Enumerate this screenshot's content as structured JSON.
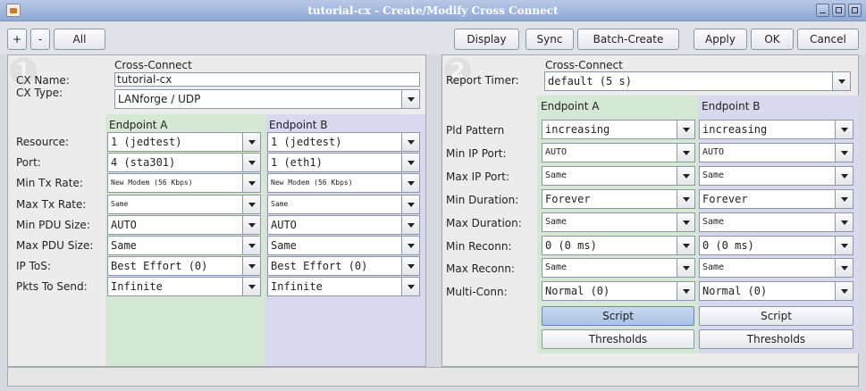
{
  "window": {
    "title": "tutorial-cx - Create/Modify Cross Connect"
  },
  "toolbar": {
    "plus": "+",
    "minus": "-",
    "all": "All",
    "display": "Display",
    "sync": "Sync",
    "batch_create": "Batch-Create",
    "apply": "Apply",
    "ok": "OK",
    "cancel": "Cancel"
  },
  "panel1": {
    "number": "1",
    "cross_connect_header": "Cross-Connect",
    "cx_name_label": "CX Name:",
    "cx_name_value": "tutorial-cx",
    "cx_type_label": "CX Type:",
    "cx_type_value": "LANforge / UDP",
    "endpoint_a": "Endpoint A",
    "endpoint_b": "Endpoint B",
    "rows": [
      {
        "label": "Resource:",
        "a": "1 (jedtest)",
        "b": "1 (jedtest)"
      },
      {
        "label": "Port:",
        "a": "4 (sta301)",
        "b": "1 (eth1)"
      },
      {
        "label": "Min Tx Rate:",
        "a": "New Modem (56 Kbps)",
        "b": "New Modem (56 Kbps)"
      },
      {
        "label": "Max Tx Rate:",
        "a": "Same",
        "b": "Same"
      },
      {
        "label": "Min PDU Size:",
        "a": "AUTO",
        "b": "AUTO"
      },
      {
        "label": "Max PDU Size:",
        "a": "Same",
        "b": "Same"
      },
      {
        "label": "IP ToS:",
        "a": "Best Effort    (0)",
        "b": "Best Effort    (0)"
      },
      {
        "label": "Pkts To Send:",
        "a": "Infinite",
        "b": "Infinite"
      }
    ]
  },
  "panel2": {
    "number": "2",
    "cross_connect_header": "Cross-Connect",
    "report_timer_label": "Report Timer:",
    "report_timer_value": "default (5 s)",
    "endpoint_a": "Endpoint A",
    "endpoint_b": "Endpoint B",
    "rows": [
      {
        "label": "Pld Pattern",
        "a": "increasing",
        "b": "increasing"
      },
      {
        "label": "Min IP Port:",
        "a": "AUTO",
        "b": "AUTO"
      },
      {
        "label": "Max IP Port:",
        "a": "Same",
        "b": "Same"
      },
      {
        "label": "Min Duration:",
        "a": "Forever",
        "b": "Forever"
      },
      {
        "label": "Max Duration:",
        "a": "Same",
        "b": "Same"
      },
      {
        "label": "Min Reconn:",
        "a": "0    (0 ms)",
        "b": "0    (0 ms)"
      },
      {
        "label": "Max Reconn:",
        "a": "Same",
        "b": "Same"
      },
      {
        "label": "Multi-Conn:",
        "a": "Normal (0)",
        "b": "Normal (0)"
      }
    ],
    "script_a": "Script",
    "script_b": "Script",
    "thresholds_a": "Thresholds",
    "thresholds_b": "Thresholds"
  },
  "status": {
    "text": ""
  }
}
